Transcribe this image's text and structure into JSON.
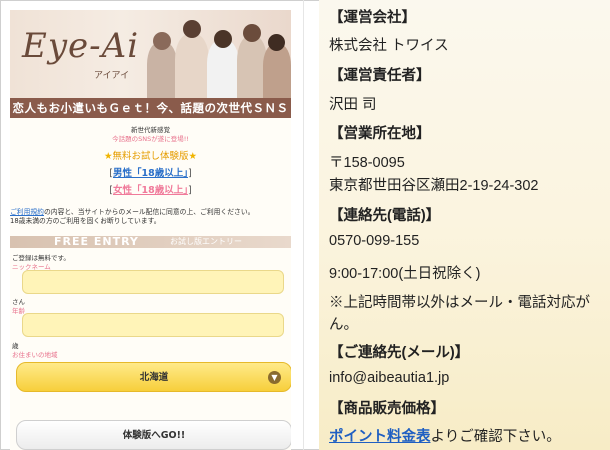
{
  "left": {
    "banner": {
      "logo": "Eye-Ai",
      "logo_sub": "アイアイ"
    },
    "tagline": "恋人もお小遣いもＧｅｔ！今、話題の次世代ＳＮＳ",
    "tiny1": "新世代新感覚",
    "tiny2": "今話題のSNSが遂に登場!!",
    "trial_prefix": "★",
    "trial_text": "無料お試し体験版",
    "trial_suffix": "★",
    "male_link": "男性「18歳以上」",
    "female_link": "女性「18歳以上」",
    "notice_link": "ご利用規約",
    "notice_text1": "の内容と、当サイトからのメール配信に同意の上、ご利用ください。",
    "notice_text2": "18歳未満の方のご利用を固くお断りしています。",
    "entry_en": "FREE ENTRY",
    "entry_jp": "お試し版エントリー",
    "registration_free": "ご登録は無料です。",
    "nickname_label": "ニックネーム",
    "san_label": "さん",
    "age_label": "年齢",
    "sai_label": "歳",
    "residence_label": "お住まいの地域",
    "region_selected": "北海道",
    "go_button": "体験版へGO!!"
  },
  "right": {
    "company_head": "【運営会社】",
    "company": "株式会社 トワイス",
    "manager_head": "【運営責任者】",
    "manager": "沢田 司",
    "office_head": "【営業所在地】",
    "postal": "〒158-0095",
    "address": "東京都世田谷区瀬田2-19-24-302",
    "tel_head": "【連絡先(電話)】",
    "tel": "0570-099-155",
    "hours": "9:00-17:00(土日祝除く)",
    "note1": "※上記時間帯以外はメール・電話対応が",
    "note2": "ん。",
    "mail_head": "【ご連絡先(メール)】",
    "mail": "info@aibeautia1.jp",
    "price_head": "【商品販売価格】",
    "price_link": "ポイント料金表",
    "price_text": "よりご確認下さい。"
  },
  "colors": {
    "tagbar": "#8a5b4b",
    "input_fill": "#fff4b8",
    "select_fill": "#f7cf3b",
    "link_blue": "#1f5fc2"
  }
}
